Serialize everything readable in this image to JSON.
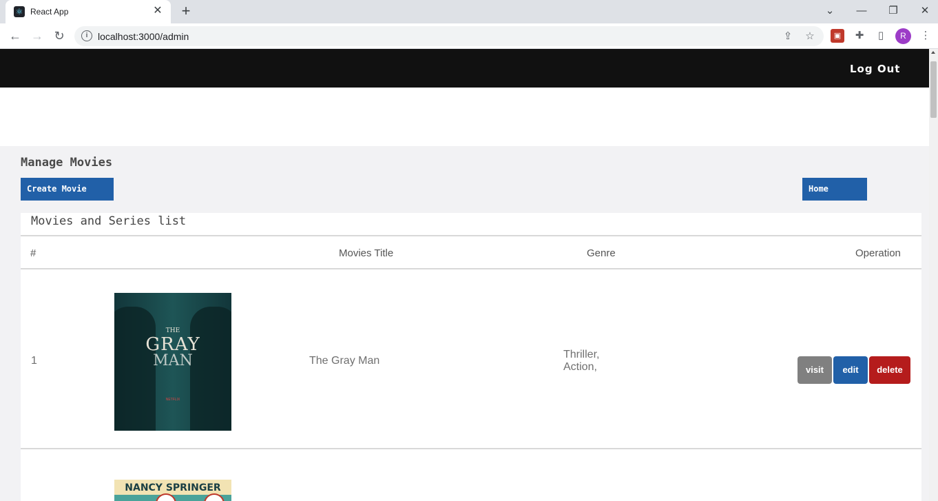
{
  "browser": {
    "tab_title": "React App",
    "url": "localhost:3000/admin",
    "avatar_letter": "R"
  },
  "navbar": {
    "logout_label": "Log Out"
  },
  "page": {
    "heading": "Manage Movies",
    "create_label": "Create Movie",
    "home_label": "Home"
  },
  "table": {
    "title": "Movies and Series list",
    "headers": [
      "#",
      "Movies Title",
      "Genre",
      "Operation"
    ],
    "rows": [
      {
        "index": "1",
        "poster_text": [
          "THE",
          "GRAY",
          "MAN",
          "NETFLIX"
        ],
        "title": "The Gray Man",
        "genres": [
          "Thriller,",
          "Action,"
        ],
        "actions": [
          "visit",
          "edit",
          "delete"
        ]
      },
      {
        "poster_text": [
          "NANCY SPRINGER"
        ]
      }
    ]
  },
  "colors": {
    "navbar_bg": "#111111",
    "primary": "#2160a8",
    "danger": "#b51c1c",
    "neutral": "#808080"
  }
}
